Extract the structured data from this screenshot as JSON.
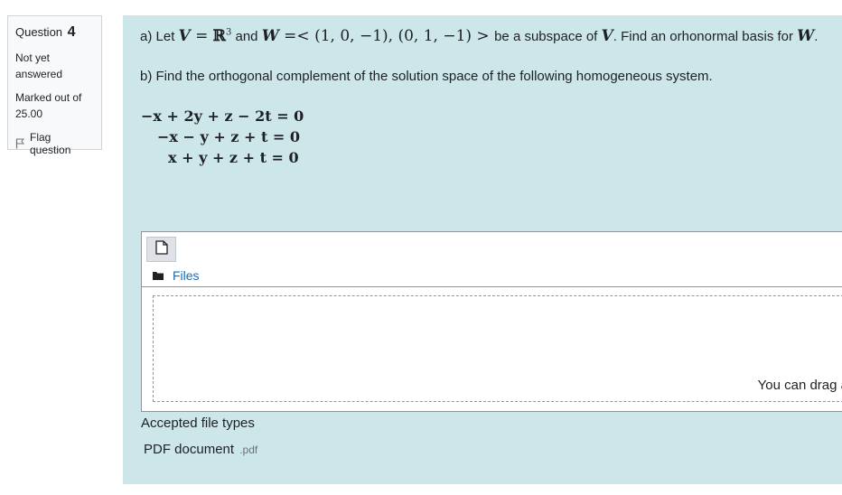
{
  "info": {
    "question_label": "Question",
    "question_number": "4",
    "state": "Not yet answered",
    "grade_label": "Marked out of",
    "grade_value": "25.00",
    "flag_label": "Flag question",
    "flag_icon": "flag-icon"
  },
  "question": {
    "part_a_prefix": "a) Let",
    "part_a_V": "V",
    "part_a_eq1": " = ",
    "part_a_R": "ℝ",
    "part_a_R_sup": "3",
    "part_a_and": " and ",
    "part_a_W": "W",
    "part_a_span": " =< (1, 0, −1), (0, 1, −1) > ",
    "part_a_mid": "be a subspace of",
    "part_a_V2": "V",
    "part_a_end": ".  Find an orhonormal basis for",
    "part_a_W2": "W",
    "part_a_dot": ".",
    "part_b": "b) Find the orthogonal complement of the solution space of the following homogeneous system.",
    "equations": [
      "−x + 2y + z − 2t = 0",
      "−x − y + z + t = 0",
      "x + y + z + t = 0"
    ]
  },
  "filepicker": {
    "add_icon": "file-add-icon",
    "folder_icon": "folder-icon",
    "files_label": "Files",
    "drop_message": "You can drag a"
  },
  "accepted": {
    "title": "Accepted file types",
    "type_name": "PDF document",
    "type_ext": ".pdf"
  }
}
